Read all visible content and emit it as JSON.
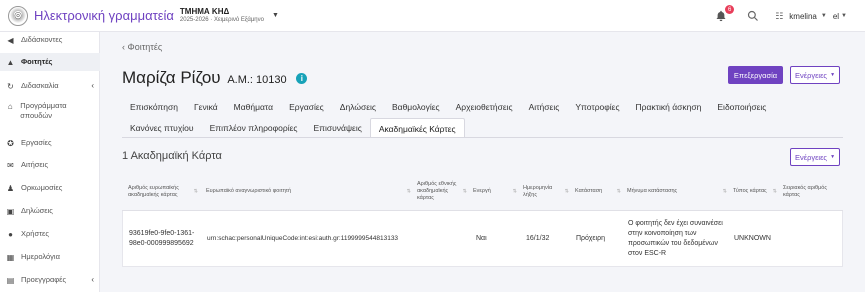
{
  "topbar": {
    "app_title": "Ηλεκτρονική γραμματεία",
    "department": "ΤΜΗΜΑ ΚΗΔ",
    "term": "2025-2026 · Χειμερινό Εξάμηνο",
    "notifications_count": "6",
    "username": "kmelina",
    "language": "el"
  },
  "sidebar": {
    "items": [
      {
        "label": "Διδάσκοντες",
        "icon": "megaphone-icon"
      },
      {
        "label": "Φοιτητές",
        "icon": "graduation-cap-icon",
        "active": true
      },
      {
        "label": "Διδασκαλία",
        "icon": "history-icon",
        "has_children": true
      },
      {
        "label": "Προγράμματα σπουδών",
        "icon": "institution-icon"
      },
      {
        "label": "Εργασίες",
        "icon": "award-icon"
      },
      {
        "label": "Αιτήσεις",
        "icon": "envelope-icon"
      },
      {
        "label": "Ορκωμοσίες",
        "icon": "user-tie-icon"
      },
      {
        "label": "Δηλώσεις",
        "icon": "trash-icon"
      },
      {
        "label": "Χρήστες",
        "icon": "user-icon"
      },
      {
        "label": "Ημερολόγια",
        "icon": "calendar-icon"
      },
      {
        "label": "Προεγγραφές",
        "icon": "folder-icon",
        "has_children": true
      }
    ]
  },
  "page": {
    "back_label": "Φοιτητές",
    "student_name": "Μαρίζα Ρίζου",
    "am_label": "Α.Μ.: 10130",
    "edit_label": "Επεξεργασία",
    "actions_label": "Ενέργειες"
  },
  "tabs": {
    "row1": [
      "Επισκόπηση",
      "Γενικά",
      "Μαθήματα",
      "Εργασίες",
      "Δηλώσεις",
      "Βαθμολογίες",
      "Αρχειοθετήσεις",
      "Αιτήσεις",
      "Υποτροφίες",
      "Πρακτική άσκηση",
      "Ειδοποιήσεις"
    ],
    "row2": [
      "Κανόνες πτυχίου",
      "Επιπλέον πληροφορίες",
      "Επισυνάψεις",
      "Ακαδημαϊκές Κάρτες"
    ],
    "active": "Ακαδημαϊκές Κάρτες"
  },
  "cards": {
    "title": "1 Ακαδημαϊκή Κάρτα",
    "actions_label": "Ενέργειες",
    "columns": [
      "Αριθμός ευρωπαϊκής ακαδημαϊκής κάρτας",
      "Ευρωπαϊκό αναγνωριστικό φοιτητή",
      "Αριθμός εθνικής ακαδημαϊκής κάρτας",
      "Ενεργή",
      "Ημερομηνία λήξης",
      "Κατάσταση",
      "Μήνυμα κατάστασης",
      "Τύπος κάρτας",
      "Σειριακός αριθμός κάρτας"
    ],
    "rows": [
      [
        "93619fe0-9fe0-1361-98e0-000999895692",
        "urn:schac:personalUniqueCode:int:esi:auth.gr:1199999544813133",
        "",
        "Ναι",
        "16/1/32",
        "Πρόχειρη",
        "Ο φοιτητής δεν έχει συναινέσει στην κοινοποίηση των προσωπικών του δεδομένων στον ESC-R",
        "UNKNOWN",
        ""
      ]
    ]
  },
  "colors": {
    "accent": "#6f42c1",
    "info": "#17a2b8",
    "badge": "#e83e5a"
  }
}
